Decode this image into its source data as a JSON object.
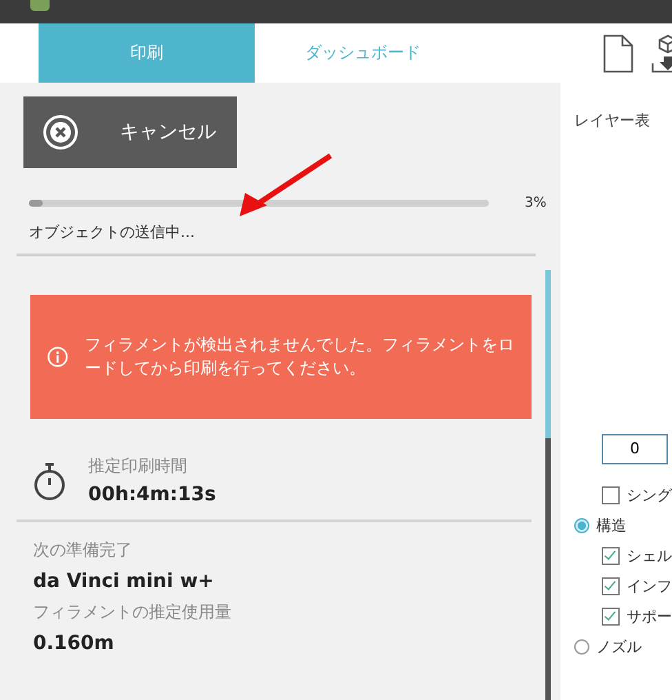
{
  "tabs": [
    {
      "label": "印刷",
      "selected": true
    },
    {
      "label": "ダッシュボード",
      "selected": false
    }
  ],
  "cancel_button": "キャンセル",
  "progress": {
    "level": 0.03,
    "percent": "3%",
    "status": "オブジェクトの送信中..."
  },
  "alert": {
    "message": "フィラメントが検出されませんでした。フィラメントをロードしてから印刷を行ってください。"
  },
  "estimate": {
    "label": "推定印刷時間",
    "value": "00h:4m:13s"
  },
  "details": [
    {
      "label": "次の準備完了",
      "value": "da Vinci mini w+"
    },
    {
      "label": "フィラメントの推定使用量",
      "value": "0.160m"
    }
  ],
  "right_panel": {
    "title": "レイヤー表",
    "layer_value": "0",
    "single": {
      "label": "シング",
      "checked": false
    },
    "views": [
      {
        "label": "構造",
        "selected": true,
        "children": [
          {
            "label": "シェル",
            "checked": true
          },
          {
            "label": "インフ",
            "checked": true
          },
          {
            "label": "サポー",
            "checked": true
          }
        ]
      },
      {
        "label": "ノズル",
        "selected": false
      }
    ]
  }
}
